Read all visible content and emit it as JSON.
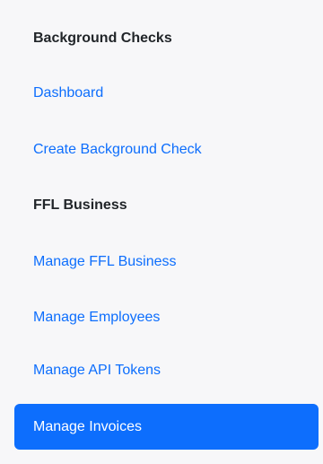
{
  "sidebar": {
    "sections": [
      {
        "header": "Background Checks",
        "items": [
          "Dashboard",
          "Create Background Check"
        ]
      },
      {
        "header": "FFL Business",
        "items": [
          "Manage FFL Business",
          "Manage Employees",
          "Manage API Tokens"
        ]
      }
    ],
    "active_item": "Manage Invoices"
  },
  "colors": {
    "link": "#0d6efd",
    "active_background": "#0d6efd",
    "active_text": "#ffffff",
    "header_text": "#212529",
    "sidebar_background": "#f7f7f9"
  }
}
